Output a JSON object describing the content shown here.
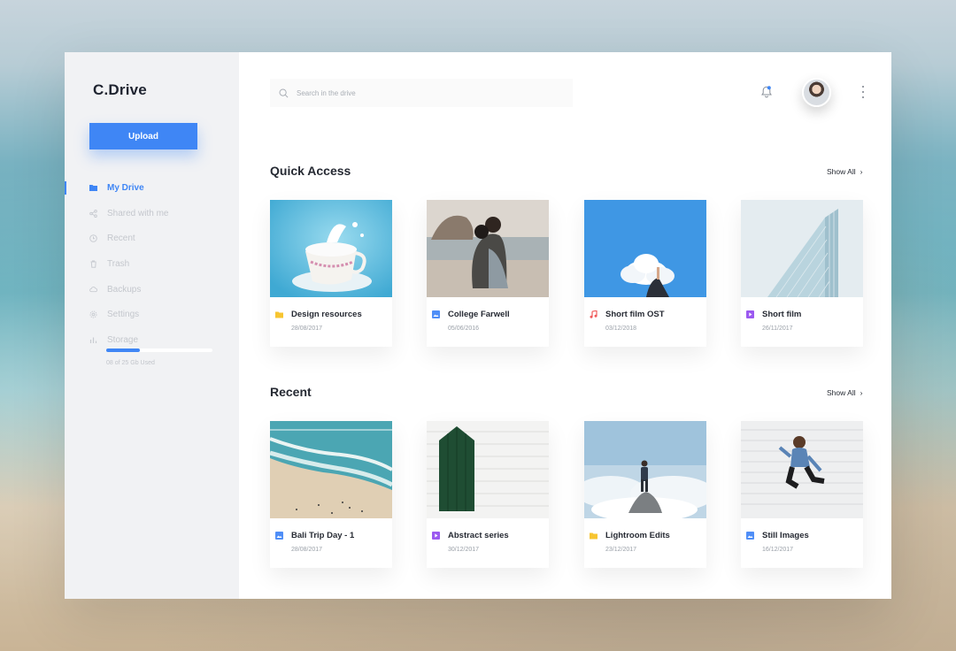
{
  "app": {
    "title": "C.Drive"
  },
  "sidebar": {
    "upload_label": "Upload",
    "items": [
      {
        "label": "My Drive",
        "icon": "folder-icon",
        "active": true
      },
      {
        "label": "Shared with me",
        "icon": "share-icon",
        "active": false
      },
      {
        "label": "Recent",
        "icon": "clock-icon",
        "active": false
      },
      {
        "label": "Trash",
        "icon": "trash-icon",
        "active": false
      },
      {
        "label": "Backups",
        "icon": "cloud-icon",
        "active": false
      },
      {
        "label": "Settings",
        "icon": "gear-icon",
        "active": false
      },
      {
        "label": "Storage",
        "icon": "bar-chart-icon",
        "active": false
      }
    ],
    "storage": {
      "used_text": "08 of 25 Gb Used",
      "used_fraction": 0.32
    }
  },
  "header": {
    "search_placeholder": "Search in the drive",
    "icons": [
      "search-icon",
      "bell-icon",
      "avatar",
      "more-vertical-icon"
    ]
  },
  "sections": {
    "quick_access": {
      "title": "Quick Access",
      "show_all": "Show All",
      "cards": [
        {
          "name": "Design resources",
          "date": "28/08/2017",
          "type": "folder-icon",
          "type_color": "#f7c531"
        },
        {
          "name": "College Farwell",
          "date": "05/06/2016",
          "type": "image-icon",
          "type_color": "#4f8ef7"
        },
        {
          "name": "Short film OST",
          "date": "03/12/2018",
          "type": "music-icon",
          "type_color": "#f05a5a"
        },
        {
          "name": "Short film",
          "date": "26/11/2017",
          "type": "video-icon",
          "type_color": "#9b59f0"
        }
      ]
    },
    "recent": {
      "title": "Recent",
      "show_all": "Show All",
      "cards": [
        {
          "name": "Bali Trip Day - 1",
          "date": "28/08/2017",
          "type": "image-icon",
          "type_color": "#4f8ef7"
        },
        {
          "name": "Abstract series",
          "date": "30/12/2017",
          "type": "video-icon",
          "type_color": "#9b59f0"
        },
        {
          "name": "Lightroom Edits",
          "date": "23/12/2017",
          "type": "folder-icon",
          "type_color": "#f7c531"
        },
        {
          "name": "Still Images",
          "date": "16/12/2017",
          "type": "image-icon",
          "type_color": "#4f8ef7"
        }
      ]
    }
  },
  "colors": {
    "accent": "#3f86f5",
    "text": "#262a33",
    "muted": "#9aa0a8"
  }
}
